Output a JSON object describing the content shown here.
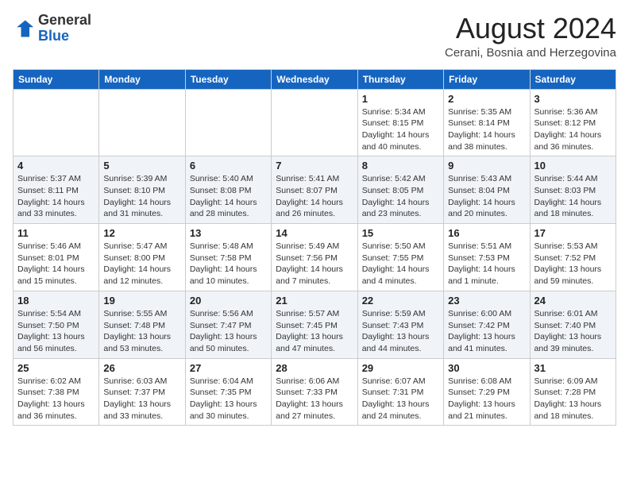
{
  "header": {
    "logo_line1": "General",
    "logo_line2": "Blue",
    "month_year": "August 2024",
    "location": "Cerani, Bosnia and Herzegovina"
  },
  "weekdays": [
    "Sunday",
    "Monday",
    "Tuesday",
    "Wednesday",
    "Thursday",
    "Friday",
    "Saturday"
  ],
  "weeks": [
    [
      {
        "day": "",
        "info": ""
      },
      {
        "day": "",
        "info": ""
      },
      {
        "day": "",
        "info": ""
      },
      {
        "day": "",
        "info": ""
      },
      {
        "day": "1",
        "info": "Sunrise: 5:34 AM\nSunset: 8:15 PM\nDaylight: 14 hours\nand 40 minutes."
      },
      {
        "day": "2",
        "info": "Sunrise: 5:35 AM\nSunset: 8:14 PM\nDaylight: 14 hours\nand 38 minutes."
      },
      {
        "day": "3",
        "info": "Sunrise: 5:36 AM\nSunset: 8:12 PM\nDaylight: 14 hours\nand 36 minutes."
      }
    ],
    [
      {
        "day": "4",
        "info": "Sunrise: 5:37 AM\nSunset: 8:11 PM\nDaylight: 14 hours\nand 33 minutes."
      },
      {
        "day": "5",
        "info": "Sunrise: 5:39 AM\nSunset: 8:10 PM\nDaylight: 14 hours\nand 31 minutes."
      },
      {
        "day": "6",
        "info": "Sunrise: 5:40 AM\nSunset: 8:08 PM\nDaylight: 14 hours\nand 28 minutes."
      },
      {
        "day": "7",
        "info": "Sunrise: 5:41 AM\nSunset: 8:07 PM\nDaylight: 14 hours\nand 26 minutes."
      },
      {
        "day": "8",
        "info": "Sunrise: 5:42 AM\nSunset: 8:05 PM\nDaylight: 14 hours\nand 23 minutes."
      },
      {
        "day": "9",
        "info": "Sunrise: 5:43 AM\nSunset: 8:04 PM\nDaylight: 14 hours\nand 20 minutes."
      },
      {
        "day": "10",
        "info": "Sunrise: 5:44 AM\nSunset: 8:03 PM\nDaylight: 14 hours\nand 18 minutes."
      }
    ],
    [
      {
        "day": "11",
        "info": "Sunrise: 5:46 AM\nSunset: 8:01 PM\nDaylight: 14 hours\nand 15 minutes."
      },
      {
        "day": "12",
        "info": "Sunrise: 5:47 AM\nSunset: 8:00 PM\nDaylight: 14 hours\nand 12 minutes."
      },
      {
        "day": "13",
        "info": "Sunrise: 5:48 AM\nSunset: 7:58 PM\nDaylight: 14 hours\nand 10 minutes."
      },
      {
        "day": "14",
        "info": "Sunrise: 5:49 AM\nSunset: 7:56 PM\nDaylight: 14 hours\nand 7 minutes."
      },
      {
        "day": "15",
        "info": "Sunrise: 5:50 AM\nSunset: 7:55 PM\nDaylight: 14 hours\nand 4 minutes."
      },
      {
        "day": "16",
        "info": "Sunrise: 5:51 AM\nSunset: 7:53 PM\nDaylight: 14 hours\nand 1 minute."
      },
      {
        "day": "17",
        "info": "Sunrise: 5:53 AM\nSunset: 7:52 PM\nDaylight: 13 hours\nand 59 minutes."
      }
    ],
    [
      {
        "day": "18",
        "info": "Sunrise: 5:54 AM\nSunset: 7:50 PM\nDaylight: 13 hours\nand 56 minutes."
      },
      {
        "day": "19",
        "info": "Sunrise: 5:55 AM\nSunset: 7:48 PM\nDaylight: 13 hours\nand 53 minutes."
      },
      {
        "day": "20",
        "info": "Sunrise: 5:56 AM\nSunset: 7:47 PM\nDaylight: 13 hours\nand 50 minutes."
      },
      {
        "day": "21",
        "info": "Sunrise: 5:57 AM\nSunset: 7:45 PM\nDaylight: 13 hours\nand 47 minutes."
      },
      {
        "day": "22",
        "info": "Sunrise: 5:59 AM\nSunset: 7:43 PM\nDaylight: 13 hours\nand 44 minutes."
      },
      {
        "day": "23",
        "info": "Sunrise: 6:00 AM\nSunset: 7:42 PM\nDaylight: 13 hours\nand 41 minutes."
      },
      {
        "day": "24",
        "info": "Sunrise: 6:01 AM\nSunset: 7:40 PM\nDaylight: 13 hours\nand 39 minutes."
      }
    ],
    [
      {
        "day": "25",
        "info": "Sunrise: 6:02 AM\nSunset: 7:38 PM\nDaylight: 13 hours\nand 36 minutes."
      },
      {
        "day": "26",
        "info": "Sunrise: 6:03 AM\nSunset: 7:37 PM\nDaylight: 13 hours\nand 33 minutes."
      },
      {
        "day": "27",
        "info": "Sunrise: 6:04 AM\nSunset: 7:35 PM\nDaylight: 13 hours\nand 30 minutes."
      },
      {
        "day": "28",
        "info": "Sunrise: 6:06 AM\nSunset: 7:33 PM\nDaylight: 13 hours\nand 27 minutes."
      },
      {
        "day": "29",
        "info": "Sunrise: 6:07 AM\nSunset: 7:31 PM\nDaylight: 13 hours\nand 24 minutes."
      },
      {
        "day": "30",
        "info": "Sunrise: 6:08 AM\nSunset: 7:29 PM\nDaylight: 13 hours\nand 21 minutes."
      },
      {
        "day": "31",
        "info": "Sunrise: 6:09 AM\nSunset: 7:28 PM\nDaylight: 13 hours\nand 18 minutes."
      }
    ]
  ]
}
